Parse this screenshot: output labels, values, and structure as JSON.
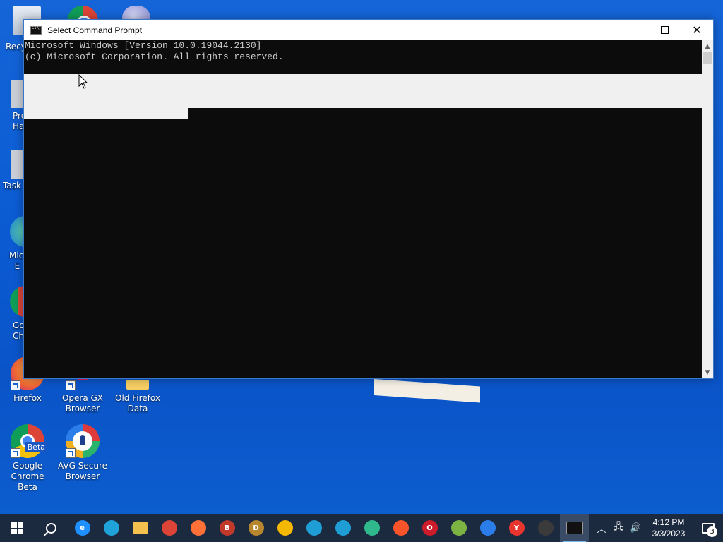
{
  "desktop": {
    "icons": [
      {
        "label_line1": "Firefox",
        "label_line2": "",
        "icon": "firefox-icon"
      },
      {
        "label_line1": "Opera GX",
        "label_line2": "Browser",
        "icon": "opera-gx-icon"
      },
      {
        "label_line1": "Old Firefox",
        "label_line2": "Data",
        "icon": "folder-icon"
      },
      {
        "label_line1": "Google",
        "label_line2": "Chrome Beta",
        "icon": "chrome-beta-icon",
        "badge": "Beta"
      },
      {
        "label_line1": "AVG Secure",
        "label_line2": "Browser",
        "icon": "avg-secure-browser-icon"
      }
    ],
    "partial_labels": [
      "Recy",
      "Pro",
      "Ha",
      "Task M",
      "Mic",
      "E",
      "Go",
      "Ch"
    ]
  },
  "window": {
    "title": "Select Command Prompt",
    "console_lines": [
      "Microsoft Windows [Version 10.0.19044.2130]",
      "(c) Microsoft Corporation. All rights reserved."
    ],
    "minimize_icon": "minimize-icon",
    "maximize_icon": "maximize-icon",
    "close_icon": "close-icon"
  },
  "taskbar": {
    "apps": [
      {
        "name": "internet-explorer",
        "color": "#1e90ff",
        "letter": "e"
      },
      {
        "name": "edge",
        "color": "#1fa3d9",
        "letter": ""
      },
      {
        "name": "file-explorer",
        "color": "#f2c14e",
        "letter": ""
      },
      {
        "name": "chrome",
        "color": "#db4437",
        "letter": ""
      },
      {
        "name": "firefox",
        "color": "#ff7139",
        "letter": ""
      },
      {
        "name": "chrome-beta",
        "color": "#c0392b",
        "letter": "B"
      },
      {
        "name": "chrome-dev",
        "color": "#b8862c",
        "letter": "D"
      },
      {
        "name": "chrome-canary",
        "color": "#f5b800",
        "letter": ""
      },
      {
        "name": "edge-beta",
        "color": "#1f9ed6",
        "letter": ""
      },
      {
        "name": "edge-dev",
        "color": "#1f9ed6",
        "letter": ""
      },
      {
        "name": "edge-canary",
        "color": "#2fb98d",
        "letter": ""
      },
      {
        "name": "brave",
        "color": "#fb542b",
        "letter": ""
      },
      {
        "name": "opera",
        "color": "#cc1b2b",
        "letter": "O"
      },
      {
        "name": "cent-browser",
        "color": "#7cb342",
        "letter": ""
      },
      {
        "name": "avg-secure-browser",
        "color": "#2b7de9",
        "letter": ""
      },
      {
        "name": "yandex",
        "color": "#e8352e",
        "letter": "Y"
      },
      {
        "name": "obs-studio",
        "color": "#3b3b3b",
        "letter": ""
      },
      {
        "name": "command-prompt",
        "color": "#111111",
        "letter": ""
      }
    ],
    "time": "4:12 PM",
    "date": "3/3/2023",
    "notifications_count": "3"
  }
}
